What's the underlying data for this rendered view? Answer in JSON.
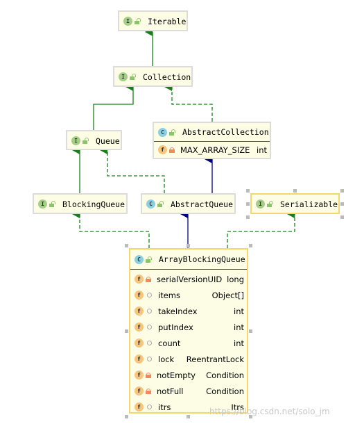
{
  "colors": {
    "inherit_interface": "#1a7f1a",
    "extends_class": "#000080",
    "node_bg": "#fdfde6",
    "selected_border": "#f5d76e"
  },
  "nodes": {
    "iterable": {
      "kind": "I",
      "name": "Iterable"
    },
    "collection": {
      "kind": "I",
      "name": "Collection"
    },
    "queue": {
      "kind": "I",
      "name": "Queue"
    },
    "abstract_collection": {
      "kind": "C",
      "name": "AbstractCollection",
      "fields": [
        {
          "name": "MAX_ARRAY_SIZE",
          "type": "int"
        }
      ]
    },
    "blocking_queue": {
      "kind": "I",
      "name": "BlockingQueue"
    },
    "abstract_queue": {
      "kind": "C",
      "name": "AbstractQueue"
    },
    "serializable": {
      "kind": "I",
      "name": "Serializable"
    },
    "array_blocking_queue": {
      "kind": "C",
      "name": "ArrayBlockingQueue",
      "fields": [
        {
          "name": "serialVersionUID",
          "type": "long",
          "icon": "f",
          "access": "private"
        },
        {
          "name": "items",
          "type": "Object[]",
          "icon": "f",
          "access": "package"
        },
        {
          "name": "takeIndex",
          "type": "int",
          "icon": "f",
          "access": "package"
        },
        {
          "name": "putIndex",
          "type": "int",
          "icon": "f",
          "access": "package"
        },
        {
          "name": "count",
          "type": "int",
          "icon": "f",
          "access": "package"
        },
        {
          "name": "lock",
          "type": "ReentrantLock",
          "icon": "f",
          "access": "package"
        },
        {
          "name": "notEmpty",
          "type": "Condition",
          "icon": "f",
          "access": "private"
        },
        {
          "name": "notFull",
          "type": "Condition",
          "icon": "f",
          "access": "private"
        },
        {
          "name": "itrs",
          "type": "Itrs",
          "icon": "f",
          "access": "package"
        }
      ]
    }
  },
  "watermark": "https://blog.csdn.net/solo_jm"
}
